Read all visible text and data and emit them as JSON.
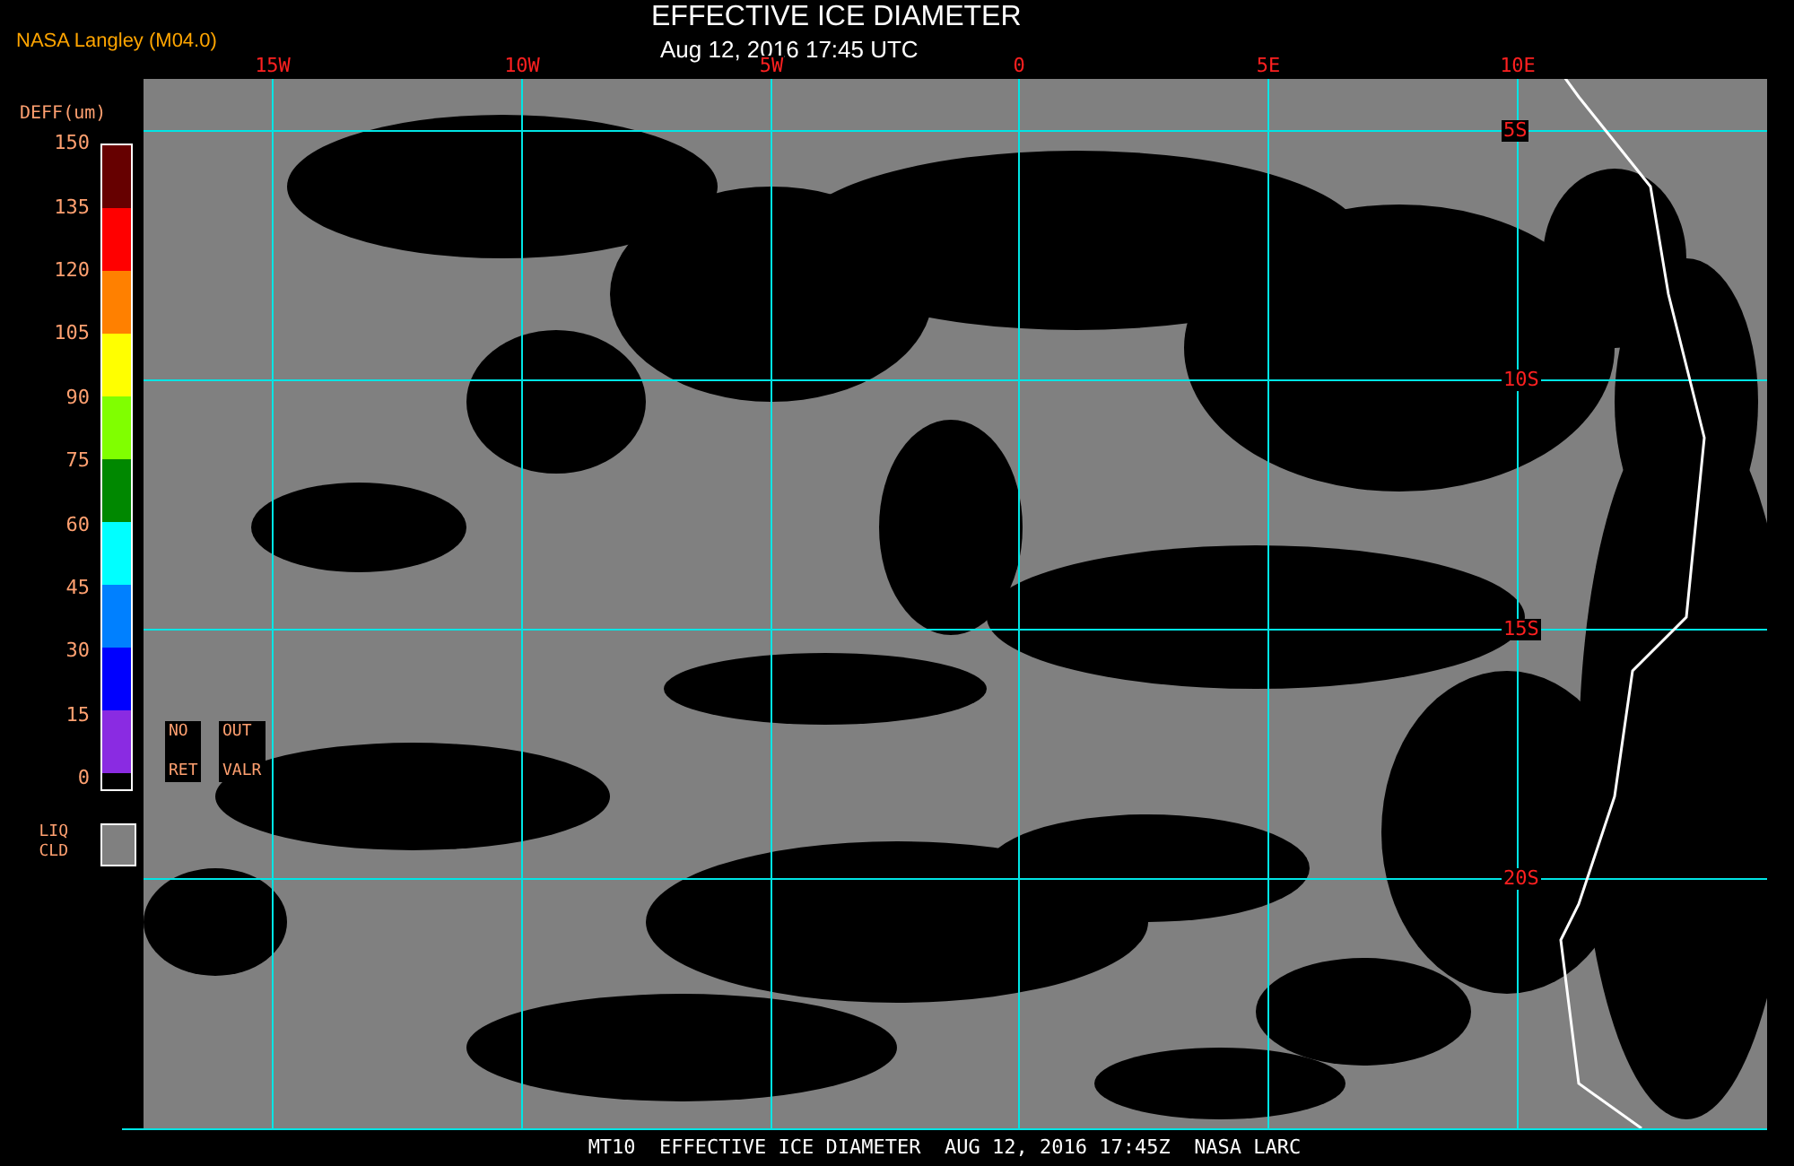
{
  "header": {
    "source": "NASA Langley (M04.0)",
    "title": "EFFECTIVE ICE DIAMETER",
    "time": "Aug 12, 2016 17:45 UTC"
  },
  "map": {
    "lon_labels": [
      "15W",
      "10W",
      "5W",
      "0",
      "5E",
      "10E"
    ],
    "lat_labels": [
      "5S",
      "10S",
      "15S",
      "20S"
    ]
  },
  "legend": {
    "unit": "DEFF(um)",
    "ticks": [
      "150",
      "135",
      "120",
      "105",
      "90",
      "75",
      "60",
      "45",
      "30",
      "15",
      "0"
    ],
    "bins": [
      {
        "color": "#660000"
      },
      {
        "color": "#ff0000"
      },
      {
        "color": "#ff8000"
      },
      {
        "color": "#ffff00"
      },
      {
        "color": "#80ff00"
      },
      {
        "color": "#008800"
      },
      {
        "color": "#00ffff"
      },
      {
        "color": "#0080ff"
      },
      {
        "color": "#0000ff"
      },
      {
        "color": "#8a2be2"
      }
    ],
    "no_ret": [
      "NO",
      "RET"
    ],
    "out_valr": [
      "OUT",
      "VALR"
    ],
    "liq_cld": [
      "LIQ",
      "CLD"
    ]
  },
  "footer": "MT10  EFFECTIVE ICE DIAMETER  AUG 12, 2016 17:45Z  NASA LARC"
}
